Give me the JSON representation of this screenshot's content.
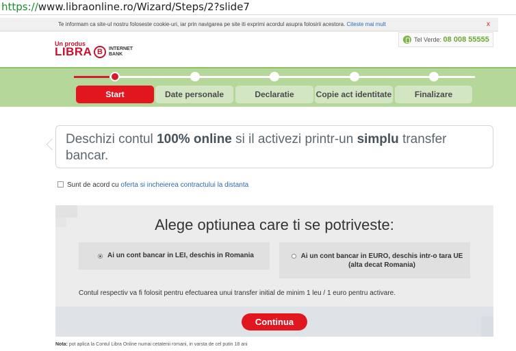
{
  "browser": {
    "url_protocol": "https://",
    "url_rest": "www.libraonline.ro/Wizard/Steps/2?slide7"
  },
  "cookie_bar": {
    "message": "Te informam ca site-ul nostru foloseste cookie-uri, iar prin navigarea pe site iti exprimi acordul asupra folosirii acestora.",
    "link": "Citeste mai mult",
    "close": "x"
  },
  "header": {
    "logo_small": "Un produs",
    "logo_big": "LIBRA",
    "logo_badge": "B",
    "logo_ib_line1": "INTERNET",
    "logo_ib_line2": "BANK",
    "tel_label": "Tel Verde:",
    "tel_number": "08 008 55555",
    "tel_icon": "phone-icon"
  },
  "steps": {
    "colors": {
      "active": "#e2161f",
      "inactive": "#d3e6c3",
      "band": "#b6d79a"
    },
    "items": [
      {
        "label": "Start",
        "active": true
      },
      {
        "label": "Date personale",
        "active": false
      },
      {
        "label": "Declaratie",
        "active": false
      },
      {
        "label": "Copie act identitate",
        "active": false
      },
      {
        "label": "Finalizare",
        "active": false
      }
    ]
  },
  "intro": {
    "part1": "Deschizi contul ",
    "bold1": "100% online",
    "part2": " si il activezi printr-un ",
    "bold2": "simplu",
    "part3": " transfer bancar."
  },
  "agreement": {
    "text": "Sunt de acord cu ",
    "link": "oferta si incheierea contractului la distanta",
    "checked": false
  },
  "options_panel": {
    "title": "Alege optiunea care ti se potriveste:",
    "option_lei": "Ai un cont bancar in LEI, deschis in Romania",
    "option_euro_line1": "Ai un cont bancar in EURO, deschis intr-o tara UE",
    "option_euro_line2": "(alta decat Romania)",
    "selected": "lei",
    "info": "Contul respectiv va fi folosit pentru efectuarea unui transfer initial de minim 1 leu / 1 euro pentru activare.",
    "continue_label": "Continua"
  },
  "footnote": {
    "label": "Nota:",
    "text": " pot aplica la Contul Libra Online numai cetatenii romani, in varsta de cel putin 18 ani"
  }
}
